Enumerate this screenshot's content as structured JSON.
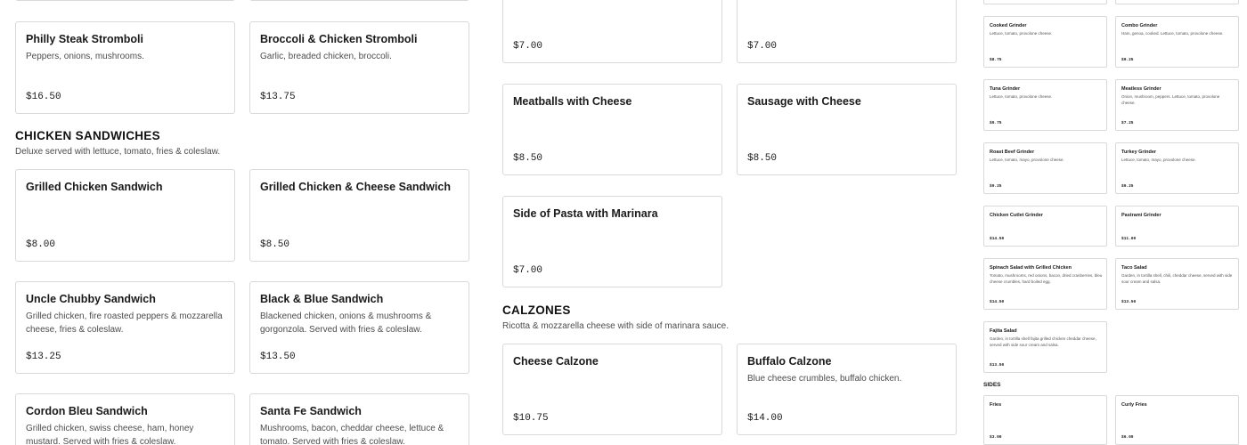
{
  "stromboli": {
    "items": [
      {
        "name": "Philly Steak Stromboli",
        "desc": "Peppers, onions, mushrooms.",
        "price": "$16.50"
      },
      {
        "name": "Broccoli & Chicken Stromboli",
        "desc": "Garlic, breaded chicken, broccoli.",
        "price": "$13.75"
      }
    ]
  },
  "chicken_sandwiches": {
    "title": "CHICKEN SANDWICHES",
    "subtitle": "Deluxe served with lettuce, tomato, fries & coleslaw.",
    "items": [
      {
        "name": "Grilled Chicken Sandwich",
        "desc": "",
        "price": "$8.00"
      },
      {
        "name": "Grilled Chicken & Cheese Sandwich",
        "desc": "",
        "price": "$8.50"
      },
      {
        "name": "Uncle Chubby Sandwich",
        "desc": "Grilled chicken, fire roasted peppers & mozzarella cheese, fries & coleslaw.",
        "price": "$13.25"
      },
      {
        "name": "Black & Blue Sandwich",
        "desc": "Blackened chicken, onions & mushrooms & gorgonzola. Served with fries & coleslaw.",
        "price": "$13.50"
      },
      {
        "name": "Cordon Bleu Sandwich",
        "desc": "Grilled chicken, swiss cheese, ham, honey mustard. Served with fries & coleslaw.",
        "price": ""
      },
      {
        "name": "Santa Fe Sandwich",
        "desc": "Mushrooms, bacon, cheddar cheese, lettuce & tomato. Served with fries & coleslaw.",
        "price": ""
      }
    ]
  },
  "pasta_sides": {
    "items": [
      {
        "name": "",
        "desc": "",
        "price": "$7.00"
      },
      {
        "name": "",
        "desc": "",
        "price": "$7.00"
      },
      {
        "name": "Meatballs with Cheese",
        "desc": "",
        "price": "$8.50"
      },
      {
        "name": "Sausage with Cheese",
        "desc": "",
        "price": "$8.50"
      },
      {
        "name": "Side of Pasta with Marinara",
        "desc": "",
        "price": "$7.00"
      }
    ]
  },
  "calzones": {
    "title": "CALZONES",
    "subtitle": "Ricotta & mozzarella cheese with side of marinara sauce.",
    "items": [
      {
        "name": "Cheese Calzone",
        "desc": "",
        "price": "$10.75"
      },
      {
        "name": "Buffalo Calzone",
        "desc": "Blue cheese crumbles, buffalo chicken.",
        "price": "$14.00"
      }
    ]
  },
  "grinders": {
    "items": [
      {
        "name": "Cooked Grinder",
        "desc": "Lettuce, tomato, provolone cheese.",
        "price": "$8.75"
      },
      {
        "name": "Combo Grinder",
        "desc": "Ham, genoa, cooked. Lettuce, tomato, provolone cheese.",
        "price": "$9.25"
      },
      {
        "name": "Tuna Grinder",
        "desc": "Lettuce, tomato, provolone cheese.",
        "price": "$9.75"
      },
      {
        "name": "Meatless Grinder",
        "desc": "Onion, mushroom, peppers. Lettuce, tomato, provolone cheese.",
        "price": "$7.25"
      },
      {
        "name": "Roast Beef Grinder",
        "desc": "Lettuce, tomato, mayo, provolone cheese.",
        "price": "$9.25"
      },
      {
        "name": "Turkey Grinder",
        "desc": "Lettuce, tomato, mayo, provolone cheese.",
        "price": "$9.25"
      },
      {
        "name": "Chicken Cutlet Grinder",
        "desc": "",
        "price": "$14.50"
      },
      {
        "name": "Pastrami Grinder",
        "desc": "",
        "price": "$11.00"
      },
      {
        "name": "Spinach Salad with Grilled Chicken",
        "desc": "Tomato, mushrooms, red onions, bacon, dried cranberries, bleu cheese crumbles, hard boiled egg.",
        "price": "$14.50"
      },
      {
        "name": "Taco Salad",
        "desc": "Garden, in tortilla shell, chili, cheddar cheese, served with side sour cream and salsa.",
        "price": "$13.50"
      },
      {
        "name": "Fajita Salad",
        "desc": "Garden, in tortilla shell fajita grilled chicken cheddar cheese, served with side sour cream and salsa.",
        "price": "$13.50"
      }
    ]
  },
  "sides": {
    "title": "SIDES",
    "items": [
      {
        "name": "Fries",
        "price": "$3.00"
      },
      {
        "name": "Curly Fries",
        "price": "$6.00"
      }
    ]
  }
}
